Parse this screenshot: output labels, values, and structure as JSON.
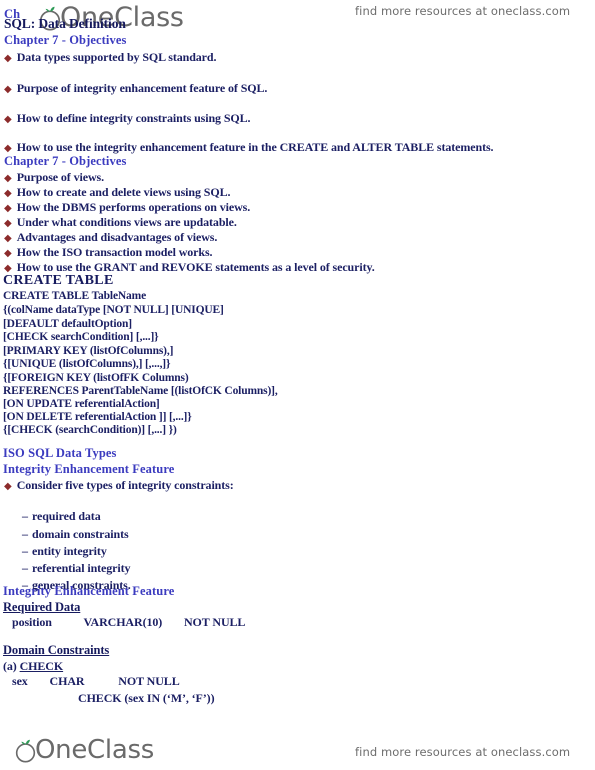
{
  "watermark": {
    "promo_text": "find more resources at oneclass.com",
    "brand_name": "OneClass",
    "leaf_color": "#2e9b57",
    "text_color": "#6d6d6d"
  },
  "document": {
    "partial_top_heading": "Ch",
    "title": "SQL: Data Definition",
    "colors": {
      "heading_blue": "#3b3bbf",
      "heading_navy": "#161a5e",
      "body_navy": "#1b1f63",
      "bullet_red": "#8c2b2b"
    }
  },
  "sections": {
    "objectives_1": {
      "heading": "Chapter 7 - Objectives",
      "bullets": [
        "Data types supported by SQL standard.",
        "Purpose of integrity enhancement feature of SQL.",
        "How to define integrity constraints using SQL.",
        "How to use the integrity enhancement feature in the CREATE and ALTER TABLE statements."
      ]
    },
    "objectives_2": {
      "heading": "Chapter 7 - Objectives",
      "bullets": [
        "Purpose of views.",
        "How to create and delete views using SQL.",
        "How the DBMS performs operations on views.",
        "Under what conditions views are updatable.",
        "Advantages and disadvantages of views.",
        "How the ISO transaction model works.",
        "How to use the GRANT and REVOKE statements as a level of security."
      ]
    },
    "create_table": {
      "heading": "CREATE TABLE",
      "syntax_lines": [
        "CREATE TABLE TableName",
        "{(colName dataType [NOT NULL] [UNIQUE]",
        "[DEFAULT defaultOption]",
        "[CHECK searchCondition] [,...]}",
        "[PRIMARY KEY (listOfColumns),]",
        "{[UNIQUE (listOfColumns),] [,...,]}",
        "{[FOREIGN KEY (listOfFK Columns)",
        " REFERENCES ParentTableName [(listOfCK Columns)],",
        " [ON UPDATE referentialAction]",
        " [ON DELETE referentialAction ]] [,...]}",
        " {[CHECK (searchCondition)] [,...] })"
      ]
    },
    "iso_data_types": {
      "heading": "ISO SQL Data Types"
    },
    "integrity_1": {
      "heading": "Integrity Enhancement Feature",
      "bullet": "Consider five types of integrity constraints:",
      "sub_items": [
        "required data",
        "domain constraints",
        "entity integrity",
        "referential integrity",
        "general constraints."
      ]
    },
    "integrity_2": {
      "heading": "Integrity Enhancement Feature",
      "required_data": {
        "heading": "Required Data",
        "example_col": "position",
        "example_type": "VARCHAR(10)",
        "example_constraint": "NOT NULL"
      },
      "domain_constraints": {
        "heading": "Domain Constraints",
        "label_a_prefix": "(a) ",
        "label_a": "CHECK",
        "example_col": "sex",
        "example_type": "CHAR",
        "example_constraint": "NOT NULL",
        "example_check": "CHECK (sex IN (‘M’, ‘F’))"
      }
    }
  }
}
